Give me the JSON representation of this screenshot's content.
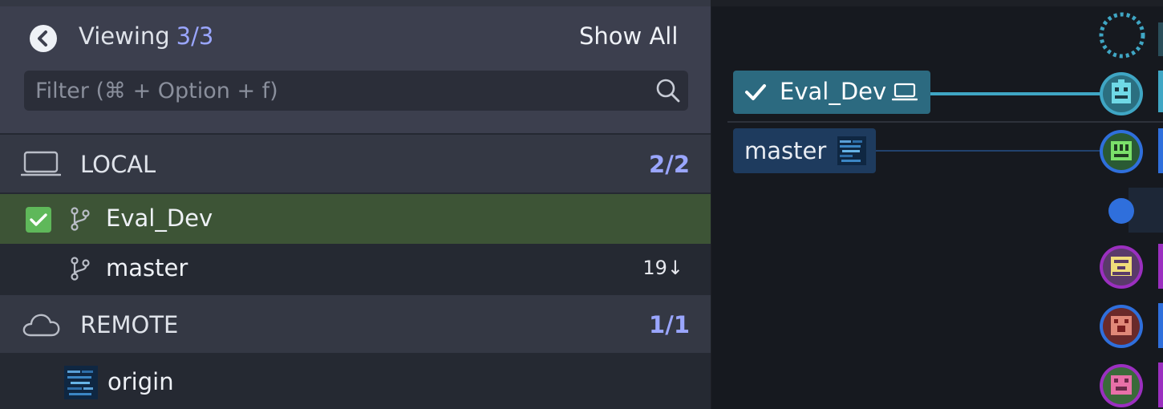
{
  "header": {
    "viewing_label": "Viewing",
    "viewing_count": "3/3",
    "show_all_label": "Show All",
    "filter_placeholder": "Filter (⌘ + Option + f)",
    "filter_value": ""
  },
  "local": {
    "label": "LOCAL",
    "count": "2/2",
    "icon": "laptop-icon",
    "branches": [
      {
        "name": "Eval_Dev",
        "checked": true,
        "behind": ""
      },
      {
        "name": "master",
        "checked": false,
        "behind": "19↓"
      }
    ]
  },
  "remote": {
    "label": "REMOTE",
    "count": "1/1",
    "icon": "cloud-icon",
    "remotes": [
      {
        "name": "origin"
      }
    ]
  },
  "graph": {
    "refs": [
      {
        "name": "Eval_Dev",
        "checked": true,
        "icon": "laptop-icon"
      },
      {
        "name": "master",
        "icon": "remote-thumbnail-icon"
      }
    ],
    "nodes": [
      {
        "type": "wip-ring"
      },
      {
        "type": "avatar",
        "ring": "teal"
      },
      {
        "type": "avatar",
        "ring": "blue"
      },
      {
        "type": "dot",
        "ring": "blue"
      },
      {
        "type": "avatar",
        "ring": "purple"
      },
      {
        "type": "avatar",
        "ring": "blue"
      },
      {
        "type": "avatar",
        "ring": "purple"
      }
    ]
  },
  "colors": {
    "accent_count": "#9aa6ff",
    "checked_row": "#3d5436",
    "checkbox": "#5fb85a",
    "eval_tag": "#2c6a80",
    "master_tag": "#1e3b5e",
    "wip_ring": "#3fa6c4",
    "blue_lane": "#2f6fdc",
    "purple_lane": "#9b2fc0"
  }
}
